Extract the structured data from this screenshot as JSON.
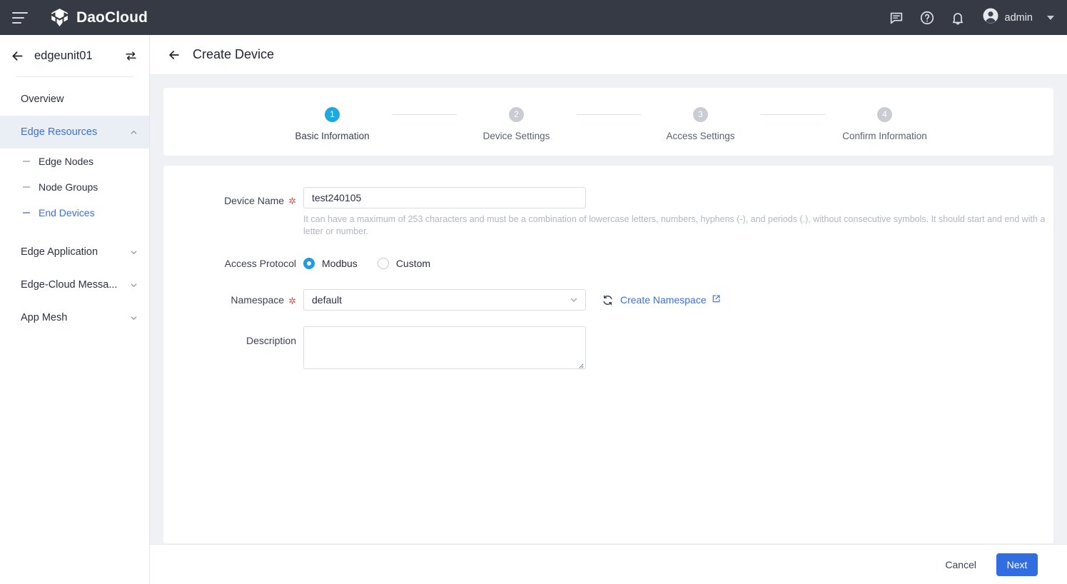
{
  "topbar": {
    "brand": "DaoCloud",
    "menu_icon": "hamburger-icon",
    "icons": [
      "chat-icon",
      "help-icon",
      "bell-icon"
    ],
    "user": "admin",
    "bg": "#353a45"
  },
  "sidebar": {
    "unit_name": "edgeunit01",
    "back_icon": "back-arrow-icon",
    "switch_icon": "swap-icon",
    "items": [
      {
        "label": "Overview",
        "type": "link",
        "active": false
      },
      {
        "label": "Edge Resources",
        "type": "group",
        "active": true,
        "expanded": true
      },
      {
        "label": "Edge Nodes",
        "type": "sub",
        "active": false
      },
      {
        "label": "Node Groups",
        "type": "sub",
        "active": false
      },
      {
        "label": "End Devices",
        "type": "sub",
        "active": true
      },
      {
        "label": "Edge Application",
        "type": "group",
        "active": false,
        "expanded": false
      },
      {
        "label": "Edge-Cloud Messa...",
        "type": "group",
        "active": false,
        "expanded": false
      },
      {
        "label": "App Mesh",
        "type": "group",
        "active": false,
        "expanded": false
      }
    ],
    "active_color": "#3f6fd8",
    "active_bg": "#eaeff5"
  },
  "page": {
    "title": "Create Device",
    "back_icon": "back-arrow-icon"
  },
  "stepper": {
    "current": 1,
    "steps": [
      {
        "num": "1",
        "label": "Basic Information"
      },
      {
        "num": "2",
        "label": "Device Settings"
      },
      {
        "num": "3",
        "label": "Access Settings"
      },
      {
        "num": "4",
        "label": "Confirm Information"
      }
    ],
    "active_color": "#1ea7e1",
    "inactive_color": "#c9ccd3"
  },
  "form": {
    "device_name": {
      "label": "Device Name",
      "required": true,
      "value": "test240105",
      "placeholder": "",
      "helper": "It can have a maximum of 253 characters and must be a combination of lowercase letters, numbers, hyphens (-), and periods (.), without consecutive symbols. It should start and end with a letter or number."
    },
    "access_protocol": {
      "label": "Access Protocol",
      "required": false,
      "options": [
        {
          "label": "Modbus",
          "selected": true
        },
        {
          "label": "Custom",
          "selected": false
        }
      ]
    },
    "namespace": {
      "label": "Namespace",
      "required": true,
      "value": "default",
      "refresh_icon": "refresh-icon",
      "create_link": "Create Namespace",
      "external_icon": "external-link-icon"
    },
    "description": {
      "label": "Description",
      "required": false,
      "value": "",
      "placeholder": ""
    }
  },
  "footer": {
    "cancel_label": "Cancel",
    "next_label": "Next",
    "primary_color": "#316ce0"
  }
}
